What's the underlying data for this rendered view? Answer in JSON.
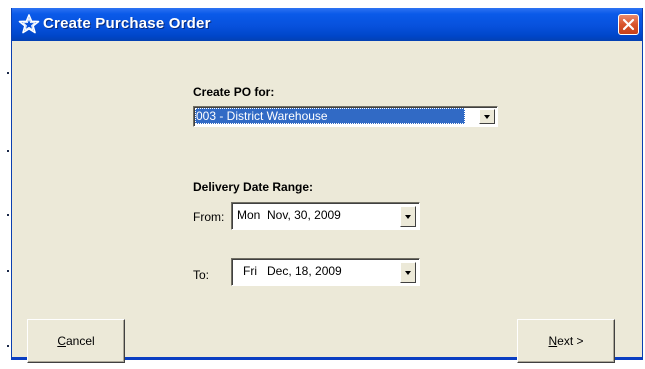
{
  "window": {
    "title": "Create Purchase Order",
    "title_icon": "star-icon",
    "close_icon": "close-icon"
  },
  "po_section": {
    "label": "Create PO for:",
    "selected_value": "003 - District Warehouse"
  },
  "date_range": {
    "label": "Delivery Date Range:",
    "from_label": "From:",
    "from_value": "Mon  Nov, 30, 2009",
    "to_label": "To:",
    "to_value": "Fri   Dec, 18, 2009"
  },
  "buttons": {
    "cancel_mnemonic": "C",
    "cancel_rest": "ancel",
    "next_mnemonic": "N",
    "next_rest": "ext >"
  },
  "colors": {
    "titlebar": "#0751dc",
    "dialog_bg": "#ece9d8",
    "selection": "#316ac5",
    "close_button": "#d9542c"
  }
}
